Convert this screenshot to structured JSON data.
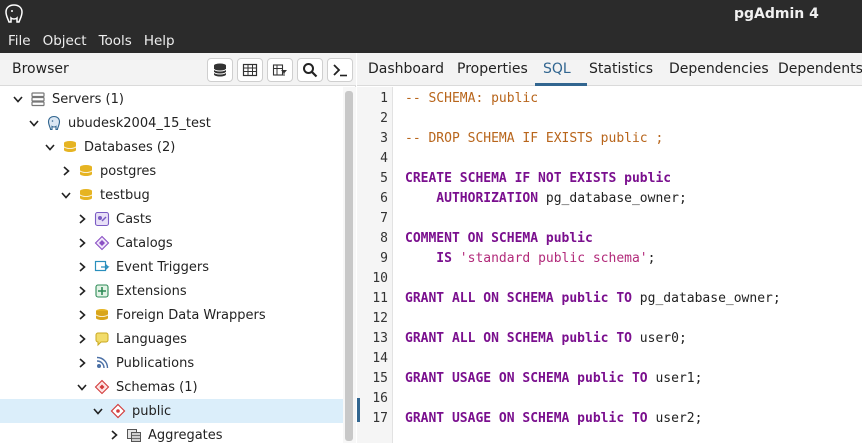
{
  "app": {
    "title": "pgAdmin 4"
  },
  "menu": [
    "File",
    "Object",
    "Tools",
    "Help"
  ],
  "browser": {
    "title": "Browser",
    "toolbar": [
      "database-icon",
      "table-icon",
      "filter-table-icon",
      "search-icon",
      "terminal-icon"
    ],
    "tree": [
      {
        "label": "Servers (1)",
        "indent": 0,
        "expanded": true,
        "icon": "servers-icon"
      },
      {
        "label": "ubudesk2004_15_test",
        "indent": 1,
        "expanded": true,
        "icon": "elephant-icon"
      },
      {
        "label": "Databases (2)",
        "indent": 2,
        "expanded": true,
        "icon": "databases-icon"
      },
      {
        "label": "postgres",
        "indent": 3,
        "expanded": false,
        "icon": "database-icon"
      },
      {
        "label": "testbug",
        "indent": 3,
        "expanded": true,
        "icon": "database-icon"
      },
      {
        "label": "Casts",
        "indent": 4,
        "expanded": false,
        "icon": "casts-icon"
      },
      {
        "label": "Catalogs",
        "indent": 4,
        "expanded": false,
        "icon": "catalogs-icon"
      },
      {
        "label": "Event Triggers",
        "indent": 4,
        "expanded": false,
        "icon": "event-triggers-icon"
      },
      {
        "label": "Extensions",
        "indent": 4,
        "expanded": false,
        "icon": "extensions-icon"
      },
      {
        "label": "Foreign Data Wrappers",
        "indent": 4,
        "expanded": false,
        "icon": "fdw-icon"
      },
      {
        "label": "Languages",
        "indent": 4,
        "expanded": false,
        "icon": "languages-icon"
      },
      {
        "label": "Publications",
        "indent": 4,
        "expanded": false,
        "icon": "publications-icon"
      },
      {
        "label": "Schemas (1)",
        "indent": 4,
        "expanded": true,
        "icon": "schemas-icon"
      },
      {
        "label": "public",
        "indent": 5,
        "expanded": true,
        "icon": "schema-icon",
        "selected": true
      },
      {
        "label": "Aggregates",
        "indent": 6,
        "expanded": false,
        "icon": "aggregates-icon"
      }
    ]
  },
  "tabs": [
    {
      "label": "Dashboard",
      "active": false
    },
    {
      "label": "Properties",
      "active": false
    },
    {
      "label": "SQL",
      "active": true
    },
    {
      "label": "Statistics",
      "active": false
    },
    {
      "label": "Dependencies",
      "active": false
    },
    {
      "label": "Dependents",
      "active": false
    }
  ],
  "sql": {
    "lines": [
      [
        {
          "t": "-- SCHEMA: public",
          "c": "comment"
        }
      ],
      [],
      [
        {
          "t": "-- DROP SCHEMA IF EXISTS public ;",
          "c": "comment"
        }
      ],
      [],
      [
        {
          "t": "CREATE SCHEMA IF NOT EXISTS public",
          "c": "kw"
        }
      ],
      [
        {
          "t": "    AUTHORIZATION",
          "c": "kw"
        },
        {
          "t": " pg_database_owner;",
          "c": "plain"
        }
      ],
      [],
      [
        {
          "t": "COMMENT ON SCHEMA public",
          "c": "kw"
        }
      ],
      [
        {
          "t": "    IS",
          "c": "kw"
        },
        {
          "t": " ",
          "c": "plain"
        },
        {
          "t": "'standard public schema'",
          "c": "str"
        },
        {
          "t": ";",
          "c": "plain"
        }
      ],
      [],
      [
        {
          "t": "GRANT ALL ON SCHEMA public TO",
          "c": "kw"
        },
        {
          "t": " pg_database_owner;",
          "c": "plain"
        }
      ],
      [],
      [
        {
          "t": "GRANT ALL ON SCHEMA public TO",
          "c": "kw"
        },
        {
          "t": " user0;",
          "c": "plain"
        }
      ],
      [],
      [
        {
          "t": "GRANT USAGE ON SCHEMA public TO",
          "c": "kw"
        },
        {
          "t": " user1;",
          "c": "plain"
        }
      ],
      [],
      [
        {
          "t": "GRANT USAGE ON SCHEMA public TO",
          "c": "kw"
        },
        {
          "t": " user2;",
          "c": "plain"
        }
      ]
    ]
  },
  "colors": {
    "accent": "#326690",
    "titlebar": "#2b2b2b",
    "selected_row": "#dbeefa",
    "comment": "#b8651b",
    "keyword": "#7a0f8e",
    "string": "#b22a7a"
  }
}
